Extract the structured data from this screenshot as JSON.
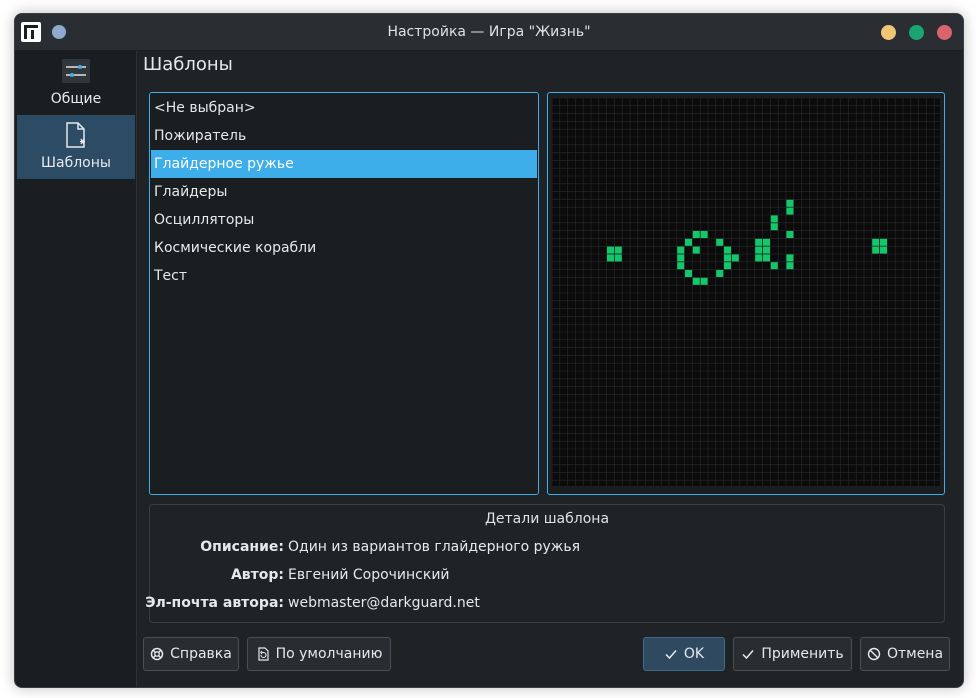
{
  "window": {
    "title": "Настройка — Игра \"Жизнь\""
  },
  "sidebar": {
    "items": [
      {
        "label": "Общие",
        "icon": "sliders-icon",
        "selected": false
      },
      {
        "label": "Шаблоны",
        "icon": "template-document-icon",
        "selected": true
      }
    ]
  },
  "page": {
    "title": "Шаблоны"
  },
  "templates": {
    "items": [
      "<Не выбран>",
      "Пожиратель",
      "Глайдерное ружье",
      "Глайдеры",
      "Осцилляторы",
      "Космические корабли",
      "Тест"
    ],
    "selected_index": 2
  },
  "preview": {
    "background": "#0b0b0b",
    "grid_color": "#2a2a2a",
    "cell_color": "#12c86a",
    "live_cells": [
      [
        7,
        19
      ],
      [
        8,
        19
      ],
      [
        7,
        20
      ],
      [
        8,
        20
      ],
      [
        18,
        17
      ],
      [
        19,
        17
      ],
      [
        17,
        18
      ],
      [
        21,
        18
      ],
      [
        16,
        19
      ],
      [
        18,
        19
      ],
      [
        22,
        19
      ],
      [
        16,
        20
      ],
      [
        22,
        20
      ],
      [
        23,
        20
      ],
      [
        16,
        21
      ],
      [
        22,
        21
      ],
      [
        17,
        22
      ],
      [
        21,
        22
      ],
      [
        18,
        23
      ],
      [
        19,
        23
      ],
      [
        26,
        18
      ],
      [
        27,
        18
      ],
      [
        26,
        19
      ],
      [
        27,
        19
      ],
      [
        26,
        20
      ],
      [
        27,
        20
      ],
      [
        28,
        21
      ],
      [
        30,
        17
      ],
      [
        28,
        16
      ],
      [
        28,
        15
      ],
      [
        30,
        14
      ],
      [
        30,
        13
      ],
      [
        30,
        20
      ],
      [
        30,
        21
      ],
      [
        41,
        18
      ],
      [
        42,
        18
      ],
      [
        41,
        19
      ],
      [
        42,
        19
      ]
    ]
  },
  "details": {
    "title": "Детали шаблона",
    "rows": [
      {
        "label": "Описание:",
        "value": "Один из вариантов глайдерного ружья"
      },
      {
        "label": "Автор:",
        "value": "Евгений Сорочинский"
      },
      {
        "label": "Эл-почта автора:",
        "value": "webmaster@darkguard.net"
      }
    ]
  },
  "buttons": {
    "help": "Справка",
    "defaults": "По умолчанию",
    "ok": "OK",
    "apply": "Применить",
    "cancel": "Отмена"
  }
}
